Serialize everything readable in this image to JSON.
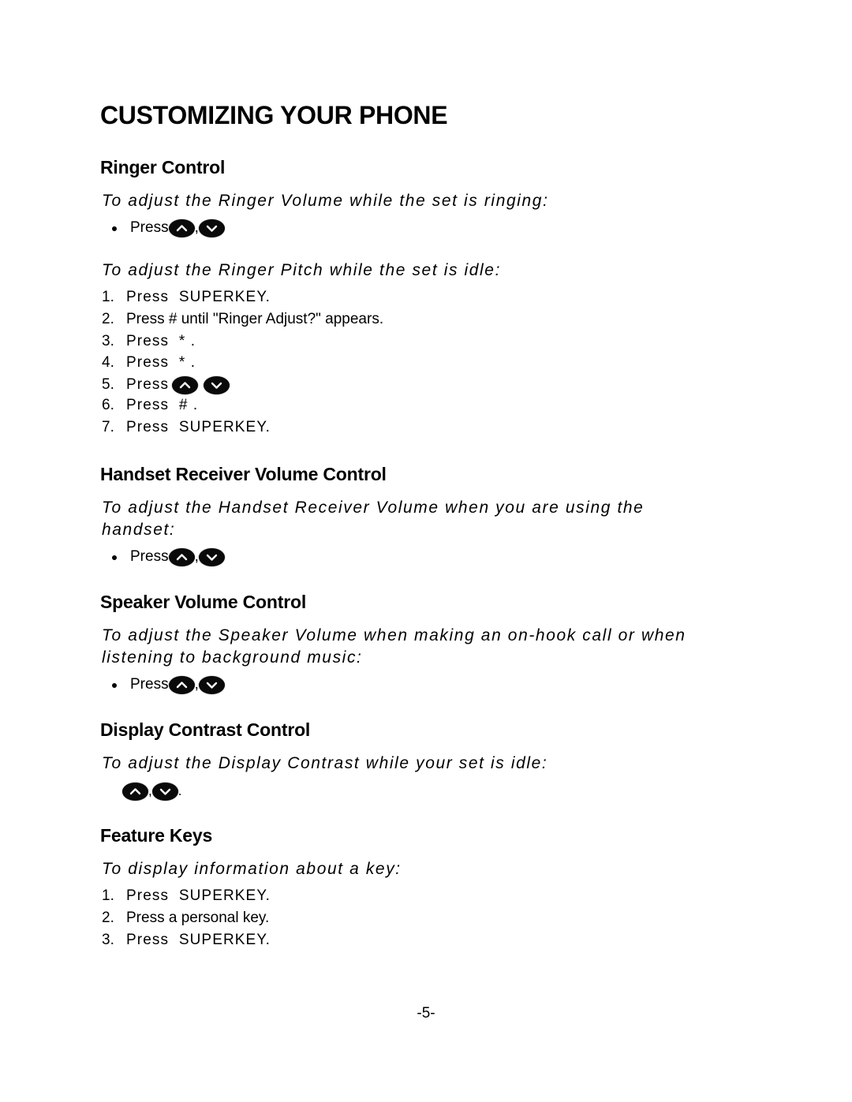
{
  "page": {
    "title": "CUSTOMIZING YOUR PHONE",
    "page_number": "-5-"
  },
  "sections": {
    "ringer": {
      "heading": "Ringer Control",
      "volume_intro": "To adjust the Ringer Volume while the set is ringing:",
      "volume_bullet": {
        "label": "Press",
        "keys": [
          "up-arrow-key",
          "down-arrow-key"
        ],
        "separator": ","
      },
      "pitch_intro": "To adjust the Ringer Pitch while the set is idle:",
      "pitch_steps": [
        {
          "num": "1.",
          "text": "Press  SUPERKEY."
        },
        {
          "num": "2.",
          "text": "Press # until \"Ringer Adjust?\" appears."
        },
        {
          "num": "3.",
          "text": "Press  * ."
        },
        {
          "num": "4.",
          "text": "Press  * ."
        },
        {
          "num": "5.",
          "text": "Press",
          "keys": [
            "up-arrow-key",
            "down-arrow-key"
          ]
        },
        {
          "num": "6.",
          "text": "Press  # ."
        },
        {
          "num": "7.",
          "text": "Press  SUPERKEY."
        }
      ]
    },
    "handset": {
      "heading": "Handset Receiver Volume Control",
      "intro_line1": "To adjust the Handset Receiver Volume when you are using the",
      "intro_line2": "handset:",
      "bullet": {
        "label": "Press",
        "keys": [
          "up-arrow-key",
          "down-arrow-key"
        ],
        "separator": ","
      }
    },
    "speaker": {
      "heading": "Speaker Volume Control",
      "intro_line1": "To adjust the Speaker Volume when making an on-hook call or when",
      "intro_line2": "listening to background music:",
      "bullet": {
        "label": "Press",
        "keys": [
          "up-arrow-key",
          "down-arrow-key"
        ],
        "separator": ","
      }
    },
    "display": {
      "heading": "Display Contrast Control",
      "intro": "To adjust the Display Contrast while your set is idle:",
      "keys": [
        "up-arrow-key",
        "down-arrow-key"
      ],
      "separator": ",",
      "terminator": "."
    },
    "feature": {
      "heading": "Feature Keys",
      "intro": "To display information about a key:",
      "steps": [
        {
          "num": "1.",
          "text": "Press  SUPERKEY."
        },
        {
          "num": "2.",
          "text": "Press a personal key."
        },
        {
          "num": "3.",
          "text": "Press  SUPERKEY."
        }
      ]
    }
  },
  "colors": {
    "text": "#000000",
    "background": "#ffffff",
    "key_fill": "#0a0a0a",
    "key_glyph": "#ffffff"
  }
}
